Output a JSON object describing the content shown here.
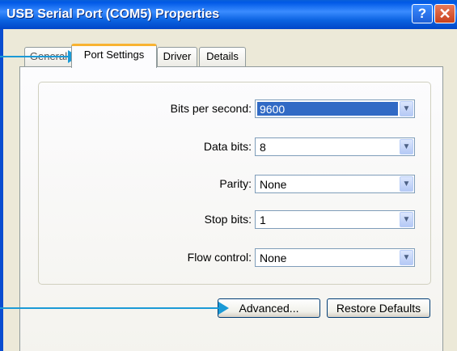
{
  "window": {
    "title": "USB Serial Port (COM5) Properties",
    "help_button": "?",
    "close_button": "✕"
  },
  "tabs": [
    {
      "label": "General",
      "active": false
    },
    {
      "label": "Port Settings",
      "active": true
    },
    {
      "label": "Driver",
      "active": false
    },
    {
      "label": "Details",
      "active": false
    }
  ],
  "settings": {
    "bits_per_second": {
      "label": "Bits per second:",
      "value": "9600"
    },
    "data_bits": {
      "label": "Data bits:",
      "value": "8"
    },
    "parity": {
      "label": "Parity:",
      "value": "None"
    },
    "stop_bits": {
      "label": "Stop bits:",
      "value": "1"
    },
    "flow_control": {
      "label": "Flow control:",
      "value": "None"
    }
  },
  "buttons": {
    "advanced": "Advanced...",
    "restore_defaults": "Restore Defaults"
  },
  "colors": {
    "titlebar": "#0058e6",
    "callout": "#1b9ad6",
    "selection": "#316ac5",
    "active_tab_accent": "#f8b332"
  }
}
